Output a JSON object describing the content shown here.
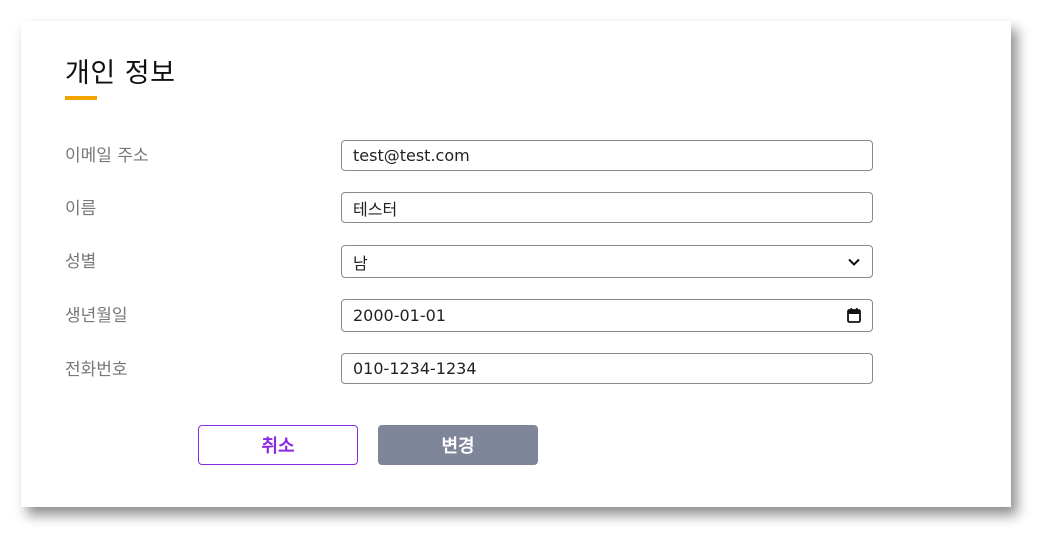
{
  "form": {
    "title": "개인 정보",
    "accent_color": "#f0a500",
    "fields": [
      {
        "label": "이메일 주소",
        "value": "test@test.com",
        "type": "text"
      },
      {
        "label": "이름",
        "value": "테스터",
        "type": "text"
      },
      {
        "label": "성별",
        "value": "남",
        "type": "select"
      },
      {
        "label": "생년월일",
        "value": "2000-01-01",
        "type": "date"
      },
      {
        "label": "전화번호",
        "value": "010-1234-1234",
        "type": "text"
      }
    ]
  },
  "actions": {
    "cancel_label": "취소",
    "cancel_color": "#8a2be2",
    "save_label": "변경",
    "save_color": "#80869a"
  },
  "icons": {
    "select": "chevron-down-icon",
    "date": "calendar-icon"
  }
}
